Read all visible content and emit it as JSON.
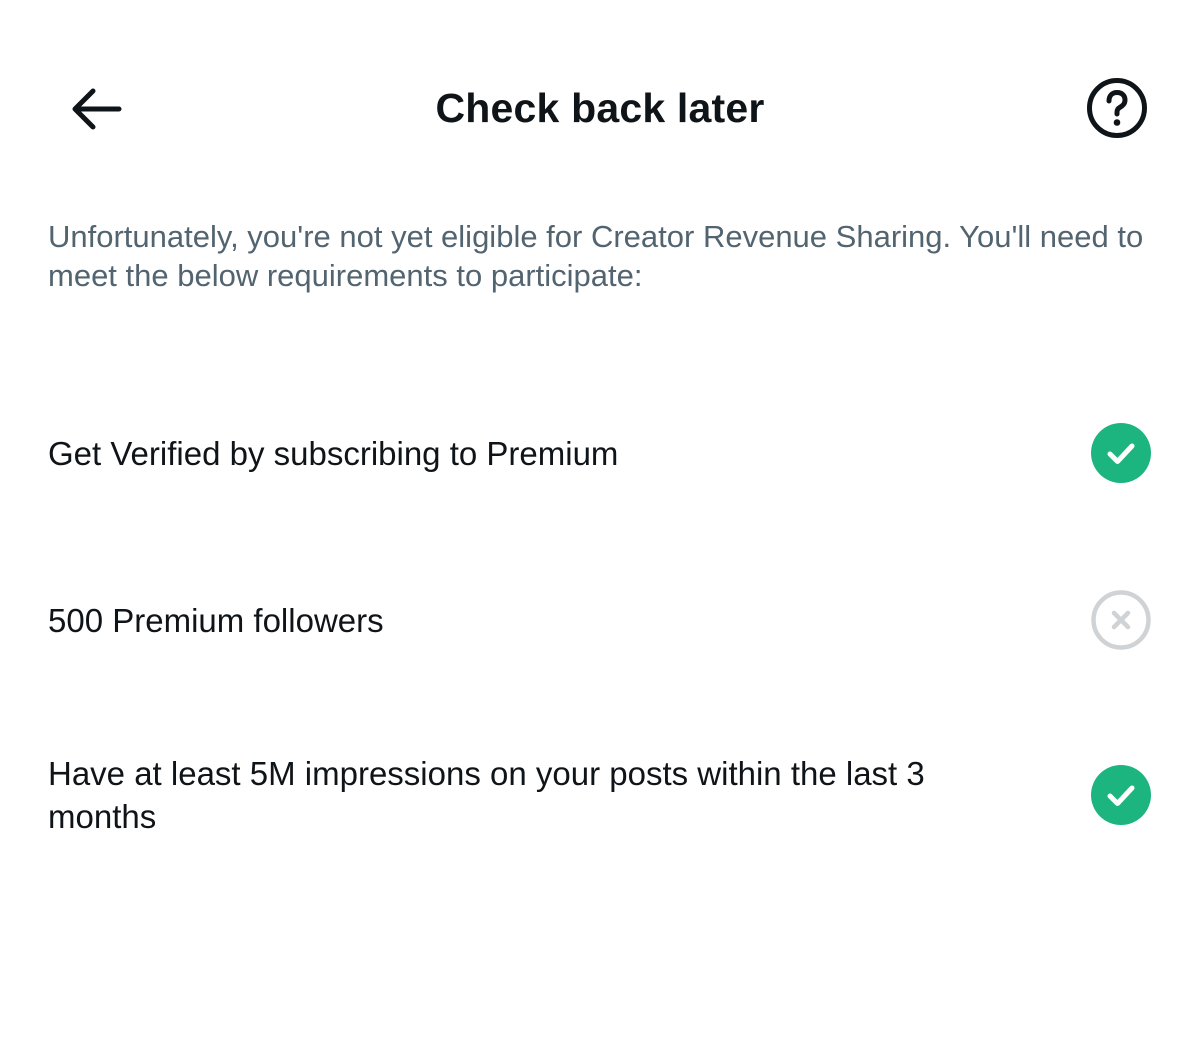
{
  "header": {
    "title": "Check back later",
    "back_icon": "arrow-left-icon",
    "help_icon": "question-circle-icon"
  },
  "intro": {
    "text": "Unfortunately, you're not yet eligible for Creator Revenue Sharing. You'll need to meet the below requirements to participate:"
  },
  "requirements": [
    {
      "label": "Get Verified by subscribing to Premium",
      "met": true,
      "status_icon": "check-circle-icon"
    },
    {
      "label": "500 Premium followers",
      "met": false,
      "status_icon": "x-circle-icon"
    },
    {
      "label": "Have at least 5M impressions on your posts within the last 3 months",
      "met": true,
      "status_icon": "check-circle-icon"
    }
  ],
  "colors": {
    "text_primary": "#0f1419",
    "text_secondary": "#536471",
    "met": "#1db57f",
    "unmet": "#cfd3d6"
  }
}
